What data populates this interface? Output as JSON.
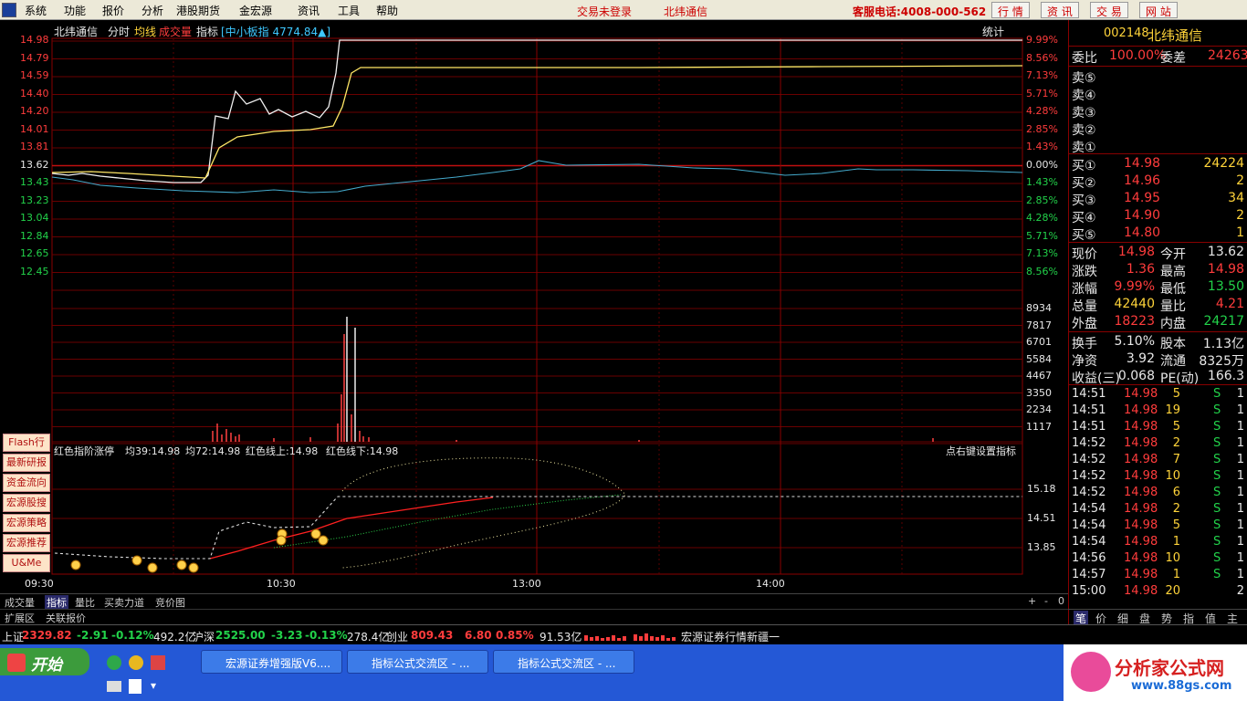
{
  "menu": {
    "items": [
      "系统",
      "功能",
      "报价",
      "分析",
      "港股期货",
      "金宏源",
      "资讯",
      "工具",
      "帮助"
    ],
    "login_status": "交易未登录",
    "stock_name": "北纬通信",
    "hotline": "客服电话:4008-000-562",
    "tabs": [
      "行 情",
      "资 讯",
      "交 易",
      "网 站"
    ]
  },
  "chart": {
    "header": {
      "name": "北纬通信",
      "tabs": [
        "分时",
        "均线",
        "成交量",
        "指标"
      ],
      "index": "[中小板指 4774.84▲]",
      "stats": "统计"
    },
    "price_labels_left": [
      "14.98",
      "14.79",
      "14.59",
      "14.40",
      "14.20",
      "14.01",
      "13.81",
      "13.62",
      "13.43",
      "13.23",
      "13.04",
      "12.84",
      "12.65",
      "12.45"
    ],
    "pct_labels_right": [
      "9.99%",
      "8.56%",
      "7.13%",
      "5.71%",
      "4.28%",
      "2.85%",
      "1.43%",
      "0.00%",
      "1.43%",
      "2.85%",
      "4.28%",
      "5.71%",
      "7.13%",
      "8.56%"
    ],
    "volume_labels": [
      "8934",
      "7817",
      "6701",
      "5584",
      "4467",
      "3350",
      "2234",
      "1117"
    ],
    "indicator": {
      "name": "红色指阶涨停",
      "ma39": "均39:14.98",
      "ma72": "均72:14.98",
      "upper": "红色线上:14.98",
      "lower": "红色线下:14.98",
      "hint": "点右键设置指标",
      "right_labels": [
        "15.18",
        "14.51",
        "13.85"
      ]
    },
    "time_labels": [
      "09:30",
      "10:30",
      "13:00",
      "14:00"
    ]
  },
  "side_buttons": [
    "Flash行情",
    "最新研报",
    "资金流向",
    "宏源股搜",
    "宏源策略",
    "宏源推荐",
    "U&Me"
  ],
  "bottom_tabs": [
    "成交量",
    "指标",
    "量比",
    "买卖力道",
    "竞价图"
  ],
  "bottom_tabs2": [
    "扩展区",
    "关联报价"
  ],
  "zoom_controls": [
    "+",
    "-",
    "0"
  ],
  "quote": {
    "code": "002148",
    "name": "北纬通信",
    "weibi_label": "委比",
    "weibi": "100.00%",
    "weicha_label": "委差",
    "weicha": "24263",
    "sell": [
      {
        "label": "卖⑤"
      },
      {
        "label": "卖④"
      },
      {
        "label": "卖③"
      },
      {
        "label": "卖②"
      },
      {
        "label": "卖①"
      }
    ],
    "buy": [
      {
        "label": "买①",
        "price": "14.98",
        "vol": "24224"
      },
      {
        "label": "买②",
        "price": "14.96",
        "vol": "2"
      },
      {
        "label": "买③",
        "price": "14.95",
        "vol": "34"
      },
      {
        "label": "买④",
        "price": "14.90",
        "vol": "2"
      },
      {
        "label": "买⑤",
        "price": "14.80",
        "vol": "1"
      }
    ],
    "stats": [
      {
        "l1": "现价",
        "v1": "14.98",
        "l2": "今开",
        "v2": "13.62"
      },
      {
        "l1": "涨跌",
        "v1": "1.36",
        "l2": "最高",
        "v2": "14.98"
      },
      {
        "l1": "涨幅",
        "v1": "9.99%",
        "l2": "最低",
        "v2": "13.50"
      },
      {
        "l1": "总量",
        "v1": "42440",
        "l2": "量比",
        "v2": "4.21"
      },
      {
        "l1": "外盘",
        "v1": "18223",
        "l2": "内盘",
        "v2": "24217"
      }
    ],
    "fund": [
      {
        "l1": "换手",
        "v1": "5.10%",
        "l2": "股本",
        "v2": "1.13亿"
      },
      {
        "l1": "净资",
        "v1": "3.92",
        "l2": "流通",
        "v2": "8325万"
      },
      {
        "l1": "收益(三)",
        "v1": "0.068",
        "l2": "PE(动)",
        "v2": "166.3"
      }
    ],
    "ticks": [
      {
        "t": "14:51",
        "p": "14.98",
        "v": "5",
        "bs": "S",
        "n": "1"
      },
      {
        "t": "14:51",
        "p": "14.98",
        "v": "19",
        "bs": "S",
        "n": "1"
      },
      {
        "t": "14:51",
        "p": "14.98",
        "v": "5",
        "bs": "S",
        "n": "1"
      },
      {
        "t": "14:52",
        "p": "14.98",
        "v": "2",
        "bs": "S",
        "n": "1"
      },
      {
        "t": "14:52",
        "p": "14.98",
        "v": "7",
        "bs": "S",
        "n": "1"
      },
      {
        "t": "14:52",
        "p": "14.98",
        "v": "10",
        "bs": "S",
        "n": "1"
      },
      {
        "t": "14:52",
        "p": "14.98",
        "v": "6",
        "bs": "S",
        "n": "1"
      },
      {
        "t": "14:54",
        "p": "14.98",
        "v": "2",
        "bs": "S",
        "n": "1"
      },
      {
        "t": "14:54",
        "p": "14.98",
        "v": "5",
        "bs": "S",
        "n": "1"
      },
      {
        "t": "14:54",
        "p": "14.98",
        "v": "1",
        "bs": "S",
        "n": "1"
      },
      {
        "t": "14:56",
        "p": "14.98",
        "v": "10",
        "bs": "S",
        "n": "1"
      },
      {
        "t": "14:57",
        "p": "14.98",
        "v": "1",
        "bs": "S",
        "n": "1"
      },
      {
        "t": "15:00",
        "p": "14.98",
        "v": "20",
        "bs": "",
        "n": "2"
      }
    ],
    "panel_tabs": [
      "笔",
      "价",
      "细",
      "盘",
      "势",
      "指",
      "值",
      "主"
    ]
  },
  "index_bar": {
    "sh_label": "上证",
    "sh_val": "2329.82",
    "sh_chg": "-2.91",
    "sh_pct": "-0.12%",
    "sh_amt": "492.2亿",
    "hs_label": "沪深",
    "hs_val": "2525.00",
    "hs_chg": "-3.23",
    "hs_pct": "-0.13%",
    "hs_amt": "278.4亿",
    "cy_label": "创业",
    "cy_val": "809.43",
    "cy_chg": "6.80",
    "cy_pct": "0.85%",
    "cy_amt": "91.53亿",
    "news": "宏源证券行情新疆一"
  },
  "taskbar": {
    "start": "开始",
    "items": [
      "宏源证券增强版V6....",
      "指标公式交流区 - ...",
      "指标公式交流区 - ..."
    ],
    "brand": "分析家公式网",
    "brand_url": "www.88gs.com"
  }
}
